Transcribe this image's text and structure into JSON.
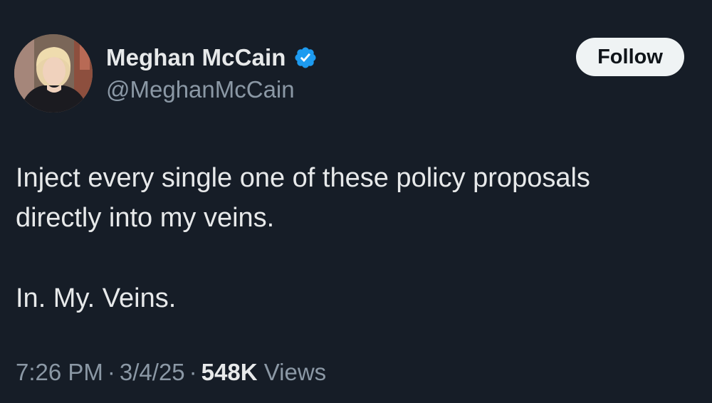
{
  "author": {
    "display_name": "Meghan McCain",
    "handle": "@MeghanMcCain",
    "verified": true,
    "verified_icon": "verified-badge-icon",
    "badge_color": "#1d9bf0"
  },
  "follow_button": {
    "label": "Follow"
  },
  "tweet": {
    "line1": "Inject every single one of these policy proposals",
    "line2": "directly into my veins.",
    "line3": "In. My. Veins."
  },
  "meta": {
    "time": "7:26 PM",
    "date": "3/4/25",
    "separator": "·",
    "views_count": "548K",
    "views_label": "Views"
  },
  "colors": {
    "background": "#161d27",
    "text_primary": "#e7e9ea",
    "text_secondary": "#8b98a5",
    "button_bg": "#eff3f4"
  }
}
